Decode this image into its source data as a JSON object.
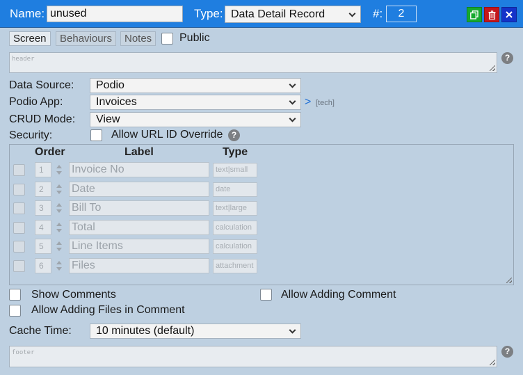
{
  "header": {
    "name_label": "Name:",
    "name_value": "unused",
    "type_label": "Type:",
    "type_value": "Data Detail Record",
    "number_label": "#:",
    "number_value": "2",
    "colors": {
      "bar": "#1f7ee0",
      "copy": "#16a92f",
      "delete": "#c4161c",
      "close": "#1433c9"
    },
    "icons": [
      "copy-icon",
      "trash-icon",
      "close-icon"
    ]
  },
  "tabs": [
    "Screen",
    "Behaviours",
    "Notes"
  ],
  "public_label": "Public",
  "header_area": {
    "placeholder": "header"
  },
  "help_glyph": "?",
  "data_source": {
    "label": "Data Source:",
    "value": "Podio"
  },
  "podio_app": {
    "label": "Podio App:",
    "value": "Invoices",
    "link_arrow": ">",
    "tech_label": "[tech]"
  },
  "crud_mode": {
    "label": "CRUD Mode:",
    "value": "View"
  },
  "security": {
    "label": "Security:",
    "option": "Allow URL ID Override"
  },
  "fields": {
    "headers": {
      "order": "Order",
      "label": "Label",
      "type": "Type"
    },
    "rows": [
      {
        "order": "1",
        "label": "Invoice No",
        "type": "text|small"
      },
      {
        "order": "2",
        "label": "Date",
        "type": "date"
      },
      {
        "order": "3",
        "label": "Bill To",
        "type": "text|large"
      },
      {
        "order": "4",
        "label": "Total",
        "type": "calculation"
      },
      {
        "order": "5",
        "label": "Line Items",
        "type": "calculation"
      },
      {
        "order": "6",
        "label": "Files",
        "type": "attachment"
      }
    ]
  },
  "options": {
    "show_comments": "Show Comments",
    "allow_adding_comment": "Allow Adding Comment",
    "allow_adding_files": "Allow Adding Files in Comment"
  },
  "cache": {
    "label": "Cache Time:",
    "value": "10 minutes (default)"
  },
  "footer_area": {
    "placeholder": "footer"
  }
}
